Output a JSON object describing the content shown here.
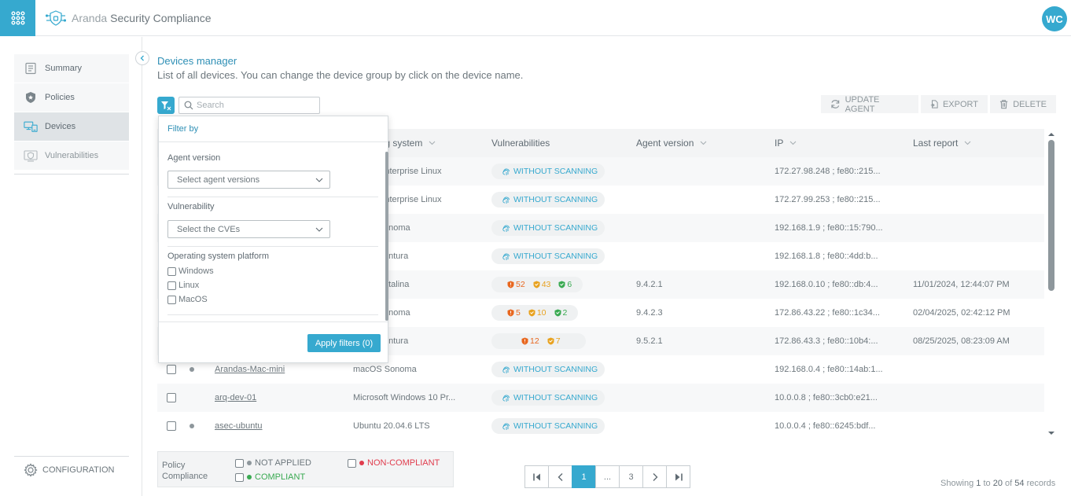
{
  "app": {
    "brand_prefix": "Aranda",
    "brand_name": "Security Compliance",
    "user_initials": "WC"
  },
  "sidebar": {
    "items": [
      {
        "label": "Summary",
        "icon": "summary-icon"
      },
      {
        "label": "Policies",
        "icon": "shield-star-icon"
      },
      {
        "label": "Devices",
        "icon": "devices-icon",
        "active": true
      },
      {
        "label": "Vulnerabilities",
        "icon": "vulnerabilities-icon"
      }
    ],
    "configuration_label": "CONFIGURATION"
  },
  "page": {
    "title": "Devices manager",
    "subtitle": "List of all devices. You can change the device group by click on the device name.",
    "search_placeholder": "Search"
  },
  "actions": {
    "update_agent": "UPDATE AGENT",
    "export": "EXPORT",
    "delete": "DELETE"
  },
  "table": {
    "columns": {
      "os": "ing system",
      "vulnerabilities": "Vulnerabilities",
      "agent_version": "Agent version",
      "ip": "IP",
      "last_report": "Last report"
    },
    "rows": [
      {
        "device": "",
        "os": "Enterprise Linux",
        "scan": "WITHOUT SCANNING",
        "agent": "",
        "ip": "172.27.98.248 ; fe80::215...",
        "report": ""
      },
      {
        "device": "",
        "os": "Enterprise Linux",
        "scan": "WITHOUT SCANNING",
        "agent": "",
        "ip": "172.27.99.253 ; fe80::215...",
        "report": ""
      },
      {
        "device": "",
        "os": "onoma",
        "scan": "WITHOUT SCANNING",
        "agent": "",
        "ip": "192.168.1.9 ; fe80::15:790...",
        "report": ""
      },
      {
        "device": "",
        "os": "entura",
        "scan": "WITHOUT SCANNING",
        "agent": "",
        "ip": "192.168.1.8 ; fe80::4dd:b...",
        "report": ""
      },
      {
        "device": "",
        "os": "atalina",
        "high": "52",
        "med": "43",
        "low": "6",
        "agent": "9.4.2.1",
        "ip": "192.168.0.10 ; fe80::db:4...",
        "report": "11/01/2024, 12:44:07 PM"
      },
      {
        "device": "",
        "os": "onoma",
        "high": "5",
        "med": "10",
        "low": "2",
        "agent": "9.4.2.3",
        "ip": "172.86.43.22 ; fe80::1c34...",
        "report": "02/04/2025, 02:42:12 PM"
      },
      {
        "device": "",
        "os": "entura",
        "high": "12",
        "med": "7",
        "agent": "9.5.2.1",
        "ip": "172.86.43.3 ; fe80::10b4:...",
        "report": "08/25/2025, 08:23:09 AM"
      },
      {
        "device": "Arandas-Mac-mini",
        "os": "macOS Sonoma",
        "scan": "WITHOUT SCANNING",
        "agent": "",
        "ip": "192.168.0.4 ; fe80::14ab:1...",
        "report": ""
      },
      {
        "device": "arq-dev-01",
        "os": "Microsoft Windows 10 Pr...",
        "scan": "WITHOUT SCANNING",
        "agent": "",
        "ip": "10.0.0.8 ; fe80::3cb0:e21...",
        "report": ""
      },
      {
        "device": "asec-ubuntu",
        "os": "Ubuntu 20.04.6 LTS",
        "scan": "WITHOUT SCANNING",
        "agent": "",
        "ip": "10.0.0.4 ; fe80::6245:bdf...",
        "report": ""
      }
    ]
  },
  "filter": {
    "header": "Filter by",
    "agent_version_label": "Agent version",
    "agent_version_placeholder": "Select agent versions",
    "vulnerability_label": "Vulnerability",
    "vulnerability_placeholder": "Select the CVEs",
    "os_label": "Operating system platform",
    "os_options": [
      "Windows",
      "Linux",
      "MacOS"
    ],
    "apply_label": "Apply filters (0)"
  },
  "legend": {
    "title": "Policy Compliance",
    "not_applied": "NOT APPLIED",
    "compliant": "COMPLIANT",
    "non_compliant": "NON-COMPLIANT"
  },
  "pagination": {
    "pages": [
      "1",
      "...",
      "3"
    ],
    "current": "1",
    "showing_prefix": "Showing",
    "from": "1",
    "to_word": "to",
    "to": "20",
    "of_word": "of",
    "total": "54",
    "records_word": "records"
  },
  "colors": {
    "accent": "#36a9cf",
    "high": "#e8671f",
    "medium": "#e8a21f",
    "low": "#3aaa52",
    "non_compliant": "#e03c4d",
    "compliant": "#3aaa52",
    "not_applied": "#8e979c"
  }
}
